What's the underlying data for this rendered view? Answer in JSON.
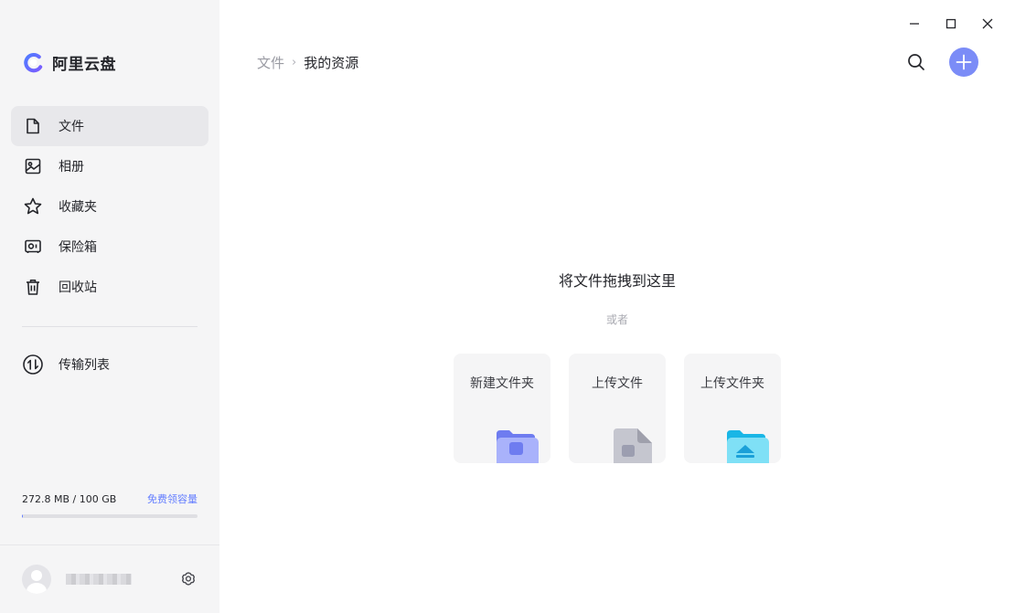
{
  "app": {
    "name": "阿里云盘",
    "accent": "#637dff"
  },
  "sidebar": {
    "items": [
      {
        "label": "文件",
        "icon": "file-icon",
        "active": true
      },
      {
        "label": "相册",
        "icon": "photo-album-icon",
        "active": false
      },
      {
        "label": "收藏夹",
        "icon": "star-icon",
        "active": false
      },
      {
        "label": "保险箱",
        "icon": "safe-icon",
        "active": false
      },
      {
        "label": "回收站",
        "icon": "trash-icon",
        "active": false
      }
    ],
    "transfer": {
      "label": "传输列表",
      "icon": "transfer-icon"
    },
    "storage": {
      "usage": "272.8 MB / 100 GB",
      "link": "免费领容量",
      "fraction": 0.003
    },
    "user": {
      "settings_icon": "settings-icon"
    }
  },
  "breadcrumb": {
    "root": "文件",
    "separator": "›",
    "current": "我的资源"
  },
  "toolbar": {
    "search_icon": "search-icon",
    "add_icon": "plus-icon"
  },
  "window_controls": [
    "minimize-icon",
    "maximize-icon",
    "close-icon"
  ],
  "drop_area": {
    "title": "将文件拖拽到这里",
    "or": "或者",
    "cards": [
      {
        "label": "新建文件夹",
        "icon": "new-folder-icon"
      },
      {
        "label": "上传文件",
        "icon": "upload-file-icon"
      },
      {
        "label": "上传文件夹",
        "icon": "upload-folder-icon"
      }
    ]
  }
}
